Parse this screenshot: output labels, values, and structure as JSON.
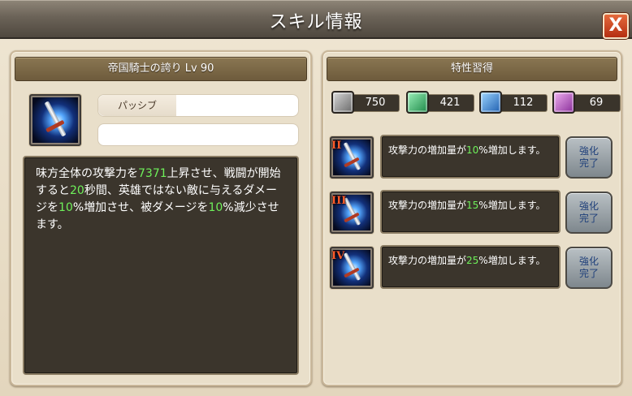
{
  "window": {
    "title": "スキル情報",
    "close_label": "X"
  },
  "skill": {
    "header": "帝国騎士の誇り Lv 90",
    "type_label": "パッシブ",
    "description_parts": [
      {
        "text": "味方全体の攻撃力を",
        "num": false
      },
      {
        "text": "7371",
        "num": true
      },
      {
        "text": "上昇させ、戦闘が開始すると",
        "num": false
      },
      {
        "text": "20",
        "num": true
      },
      {
        "text": "秒間、英雄ではない敵に与えるダメージを",
        "num": false
      },
      {
        "text": "10",
        "num": true
      },
      {
        "text": "%増加させ、被ダメージを",
        "num": false
      },
      {
        "text": "10",
        "num": true
      },
      {
        "text": "%減少させます。",
        "num": false
      }
    ]
  },
  "traits": {
    "header": "特性習得",
    "resources": [
      {
        "icon": "gray-gem-icon",
        "color": "#9a9a9a",
        "value": "750"
      },
      {
        "icon": "green-gem-icon",
        "color": "#2fbf6a",
        "value": "421"
      },
      {
        "icon": "blue-gem-icon",
        "color": "#2f8fe0",
        "value": "112"
      },
      {
        "icon": "purple-gem-icon",
        "color": "#c060c8",
        "value": "69"
      }
    ],
    "rows": [
      {
        "level": "II",
        "prefix": "攻撃力の増加量が",
        "num": "10",
        "suffix": "%増加します。",
        "button": "強化\n完了"
      },
      {
        "level": "III",
        "prefix": "攻撃力の増加量が",
        "num": "15",
        "suffix": "%増加します。",
        "button": "強化\n完了"
      },
      {
        "level": "IV",
        "prefix": "攻撃力の増加量が",
        "num": "25",
        "suffix": "%増加します。",
        "button": "強化\n完了"
      }
    ]
  }
}
